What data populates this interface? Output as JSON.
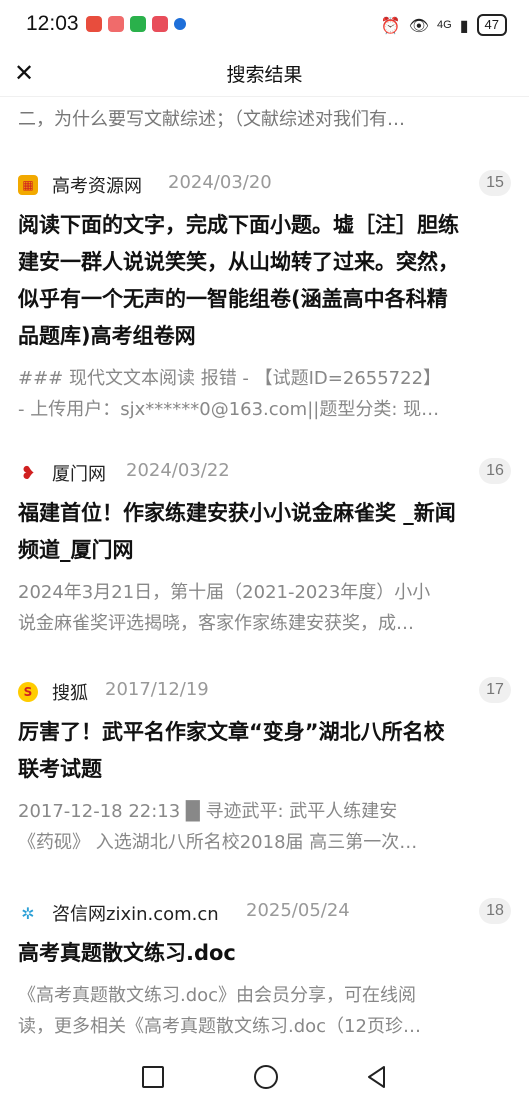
{
  "status": {
    "time": "12:03",
    "network": "4G",
    "battery": "47"
  },
  "header": {
    "title": "搜索结果"
  },
  "top_snippet": "二，为什么要写文献综述；（文献综述对我们有…",
  "results": [
    {
      "source": "高考资源网",
      "date": "2024/03/20",
      "rank": "15",
      "title_lines": [
        "阅读下面的文字，完成下面小题。墟［注］胆练",
        "建安一群人说说笑笑，从山坳转了过来。突然，",
        "似乎有一个无声的一智能组卷(涵盖高中各科精",
        "品题库)高考组卷网"
      ],
      "desc_lines": [
        "### 现代文文本阅读 报错 - 【试题ID=2655722】",
        "- 上传用户：sjx******0@163.com||题型分类: 现…"
      ]
    },
    {
      "source": "厦门网",
      "date": "2024/03/22",
      "rank": "16",
      "title_lines": [
        "福建首位！作家练建安获小小说金麻雀奖 _新闻",
        "频道_厦门网"
      ],
      "desc_lines": [
        "2024年3月21日，第十届（2021-2023年度）小小",
        "说金麻雀奖评选揭晓，客家作家练建安获奖，成…"
      ]
    },
    {
      "source": "搜狐",
      "date": "2017/12/19",
      "rank": "17",
      "title_lines": [
        "厉害了！武平名作家文章“变身”湖北八所名校",
        "联考试题"
      ],
      "desc_lines": [
        "2017-12-18 22:13 █ 寻迹武平:    武平人练建安",
        "《药砚》 入选湖北八所名校2018届  高三第一次…"
      ]
    },
    {
      "source": "咨信网zixin.com.cn",
      "date": "2025/05/24",
      "rank": "18",
      "title_lines": [
        "高考真题散文练习.doc"
      ],
      "desc_lines": [
        "《高考真题散文练习.doc》由会员分享，可在线阅",
        "读，更多相关《高考真题散文练习.doc（12页珍…"
      ]
    }
  ]
}
